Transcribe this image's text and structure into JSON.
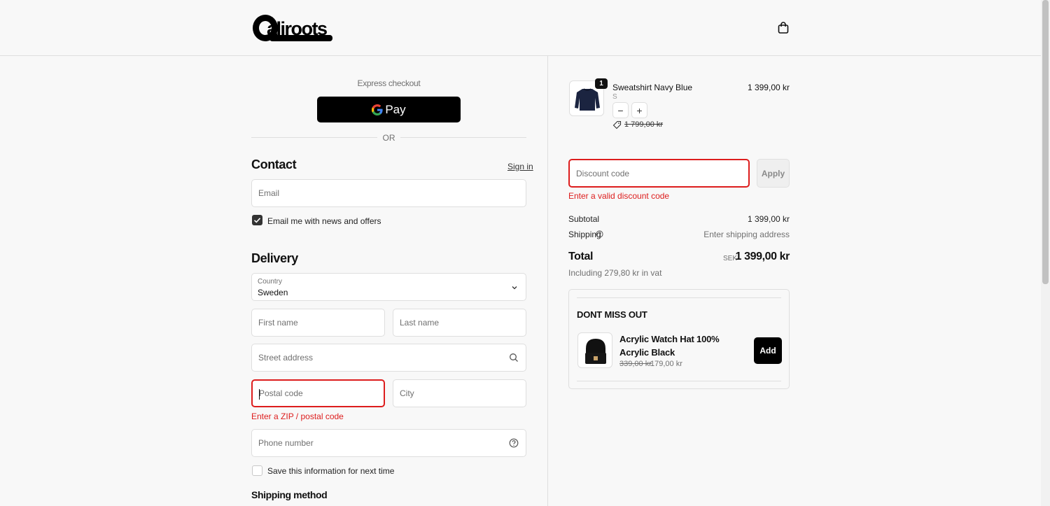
{
  "header": {
    "logo_text": "aliroots",
    "cart_icon": "shopping-bag-icon"
  },
  "express": {
    "label": "Express checkout",
    "gpay_label": "Pay",
    "or_label": "OR"
  },
  "contact": {
    "heading": "Contact",
    "sign_in": "Sign in",
    "email_placeholder": "Email",
    "newsletter_label": "Email me with news and offers",
    "newsletter_checked": true
  },
  "delivery": {
    "heading": "Delivery",
    "country_label": "Country",
    "country_value": "Sweden",
    "first_name_placeholder": "First name",
    "last_name_placeholder": "Last name",
    "street_placeholder": "Street address",
    "postal_placeholder": "Postal code",
    "city_placeholder": "City",
    "postal_error": "Enter a ZIP / postal code",
    "phone_placeholder": "Phone number",
    "save_info_label": "Save this information for next time",
    "save_info_checked": false
  },
  "shipping_method": {
    "heading": "Shipping method"
  },
  "cart": {
    "item": {
      "quantity": "1",
      "name": "Sweatshirt Navy Blue",
      "variant": "S",
      "price": "1 399,00 kr",
      "compare_price": "1 799,00 kr",
      "decrement": "−",
      "increment": "+"
    },
    "discount": {
      "placeholder": "Discount code",
      "apply": "Apply",
      "error": "Enter a valid discount code"
    },
    "subtotal_label": "Subtotal",
    "subtotal_value": "1 399,00 kr",
    "shipping_label": "Shipping",
    "shipping_value": "Enter shipping address",
    "total_label": "Total",
    "total_currency": "SEK",
    "total_value": "1 399,00 kr",
    "vat_note": "Including 279,80 kr in vat"
  },
  "upsell": {
    "title": "DONT MISS OUT",
    "product_name": "Acrylic Watch Hat 100% Acrylic Black",
    "old_price": "339,00 kr",
    "new_price": "179,00 kr",
    "add_label": "Add"
  },
  "colors": {
    "error": "#dd1d1d",
    "primary_button": "#000000",
    "background": "#f8f8f8"
  }
}
